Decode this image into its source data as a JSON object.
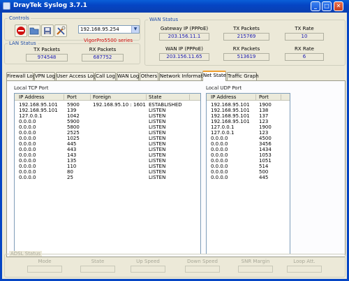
{
  "window": {
    "title": "DrayTek Syslog 3.7.1"
  },
  "controls": {
    "label": "Controls",
    "router_ip": "192.168.95.254",
    "router_model": "VigorPro5500 series"
  },
  "lan_status": {
    "label": "LAN Status",
    "tx_label": "TX Packets",
    "tx_value": "974548",
    "rx_label": "RX Packets",
    "rx_value": "687752"
  },
  "wan_status": {
    "label": "WAN Status",
    "gateway_label": "Gateway IP (PPPoE)",
    "gateway_value": "203.156.11.1",
    "tx_label": "TX Packets",
    "tx_value": "215769",
    "tx_rate_label": "TX Rate",
    "tx_rate_value": "10",
    "wan_ip_label": "WAN IP (PPPoE)",
    "wan_ip_value": "203.156.11.65",
    "rx_label": "RX Packets",
    "rx_value": "513619",
    "rx_rate_label": "RX Rate",
    "rx_rate_value": "6"
  },
  "tabs": [
    "Firewall Log",
    "VPN Log",
    "User Access Log",
    "Call Log",
    "WAN Log",
    "Others",
    "Network Information",
    "Net State",
    "Traffic Graph"
  ],
  "tcp": {
    "label": "Local TCP Port",
    "headers": [
      "IP Address",
      "Port",
      "Foreign",
      "State"
    ],
    "rows": [
      [
        "192.168.95.101",
        "5900",
        "192.168.95.10 : 1601",
        "ESTABLISHED"
      ],
      [
        "192.168.95.101",
        "139",
        "",
        "LISTEN"
      ],
      [
        "127.0.0.1",
        "1042",
        "",
        "LISTEN"
      ],
      [
        "0.0.0.0",
        "5900",
        "",
        "LISTEN"
      ],
      [
        "0.0.0.0",
        "5800",
        "",
        "LISTEN"
      ],
      [
        "0.0.0.0",
        "2525",
        "",
        "LISTEN"
      ],
      [
        "0.0.0.0",
        "1025",
        "",
        "LISTEN"
      ],
      [
        "0.0.0.0",
        "445",
        "",
        "LISTEN"
      ],
      [
        "0.0.0.0",
        "443",
        "",
        "LISTEN"
      ],
      [
        "0.0.0.0",
        "143",
        "",
        "LISTEN"
      ],
      [
        "0.0.0.0",
        "135",
        "",
        "LISTEN"
      ],
      [
        "0.0.0.0",
        "110",
        "",
        "LISTEN"
      ],
      [
        "0.0.0.0",
        "80",
        "",
        "LISTEN"
      ],
      [
        "0.0.0.0",
        "25",
        "",
        "LISTEN"
      ]
    ]
  },
  "udp": {
    "label": "Local UDP Port",
    "headers": [
      "IP Address",
      "Port"
    ],
    "rows": [
      [
        "192.168.95.101",
        "1900"
      ],
      [
        "192.168.95.101",
        "138"
      ],
      [
        "192.168.95.101",
        "137"
      ],
      [
        "192.168.95.101",
        "123"
      ],
      [
        "127.0.0.1",
        "1900"
      ],
      [
        "127.0.0.1",
        "123"
      ],
      [
        "0.0.0.0",
        "4500"
      ],
      [
        "0.0.0.0",
        "3456"
      ],
      [
        "0.0.0.0",
        "1434"
      ],
      [
        "0.0.0.0",
        "1053"
      ],
      [
        "0.0.0.0",
        "1051"
      ],
      [
        "0.0.0.0",
        "514"
      ],
      [
        "0.0.0.0",
        "500"
      ],
      [
        "0.0.0.0",
        "445"
      ]
    ]
  },
  "adsl_status": {
    "label": "ADSL Status",
    "fields": [
      "Mode",
      "State",
      "Up Speed",
      "Down Speed",
      "SNR Margin",
      "Loop Att."
    ]
  }
}
